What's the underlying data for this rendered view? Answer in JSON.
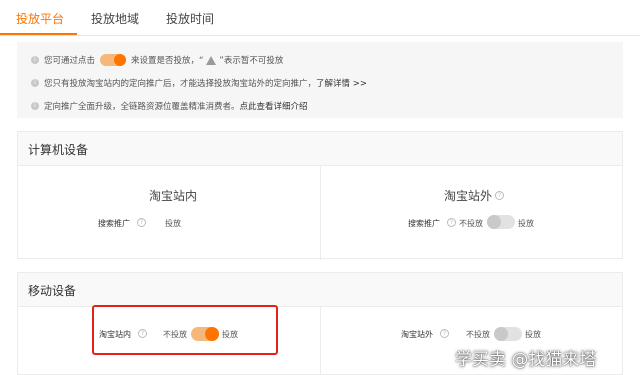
{
  "tabs": [
    "投放平台",
    "投放地域",
    "投放时间"
  ],
  "info": {
    "line1_pre": "您可通过点击",
    "line1_mid": "来设置是否投放，“",
    "line1_post": "”表示暂不可投放",
    "line2_text": "您只有投放淘宝站内的定向推广后，才能选择投放淘宝站外的定向推广，",
    "line2_link": "了解详情 >>",
    "line3_text": "定向推广全面升级，全链路资源位覆盖精准消费者。",
    "line3_link": "点此查看详细介绍"
  },
  "computer": {
    "title": "计算机设备",
    "inside_title": "淘宝站内",
    "inside_row_label": "搜索推广",
    "inside_value": "投放",
    "outside_title": "淘宝站外",
    "outside_row_label": "搜索推广",
    "outside_off": "不投放",
    "outside_on": "投放"
  },
  "mobile": {
    "title": "移动设备",
    "inside_label": "淘宝站内",
    "inside_off": "不投放",
    "inside_on": "投放",
    "outside_label": "淘宝站外",
    "outside_off": "不投放",
    "outside_on": "投放"
  },
  "watermark": "学买卖 @找猫来塔",
  "colors": {
    "accent": "#ff7300",
    "highlight_border": "#e2231a"
  }
}
